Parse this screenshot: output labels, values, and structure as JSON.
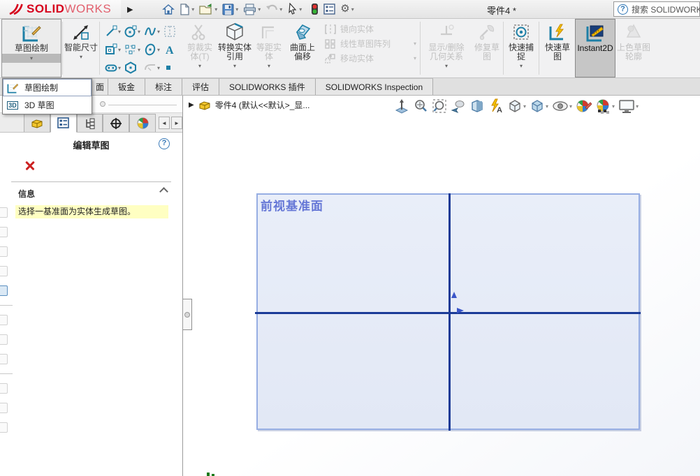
{
  "titlebar": {
    "brand_bold": "SOLID",
    "brand_light": "WORKS",
    "document_title": "零件4 *",
    "search_label": "搜索 SOLIDWORKS"
  },
  "ribbon": {
    "sketch": "草图绘制",
    "smart_dimension": "智能尺寸",
    "trim": "剪裁实体(T)",
    "convert": "转换实体引用",
    "offset": "等距实体",
    "offset_surface": "曲面上偏移",
    "mirror": "镜向实体",
    "linear_pattern": "线性草图阵列",
    "move": "移动实体",
    "relations": "显示/删除几何关系",
    "repair": "修复草图",
    "quick_snaps": "快速捕捉",
    "rapid_sketch": "快速草图",
    "instant2d": "Instant2D",
    "shaded_contours": "上色草图轮廓"
  },
  "tabs": {
    "partial": "面",
    "items": [
      {
        "label": "钣金"
      },
      {
        "label": "标注"
      },
      {
        "label": "评估"
      },
      {
        "label": "SOLIDWORKS 插件"
      },
      {
        "label": "SOLIDWORKS Inspection"
      }
    ]
  },
  "sketch_menu": {
    "items": [
      {
        "label": "草图绘制"
      },
      {
        "label": "3D 草图"
      }
    ]
  },
  "feature_tree": {
    "root": "零件4 (默认<<默认>_显..."
  },
  "property_panel": {
    "title": "编辑草图",
    "section_info": "信息",
    "message": "选择一基准面为实体生成草图。"
  },
  "viewport": {
    "plane_label": "前视基准面"
  },
  "colors": {
    "brand_red": "#d6001c",
    "plane_fill": "#e9eef9",
    "plane_border": "#97aee3",
    "axis_blue": "#1b3b97",
    "plane_label_blue": "#6577d6",
    "message_yellow": "#ffffc2",
    "icon_teal": "#1d7fa6"
  }
}
